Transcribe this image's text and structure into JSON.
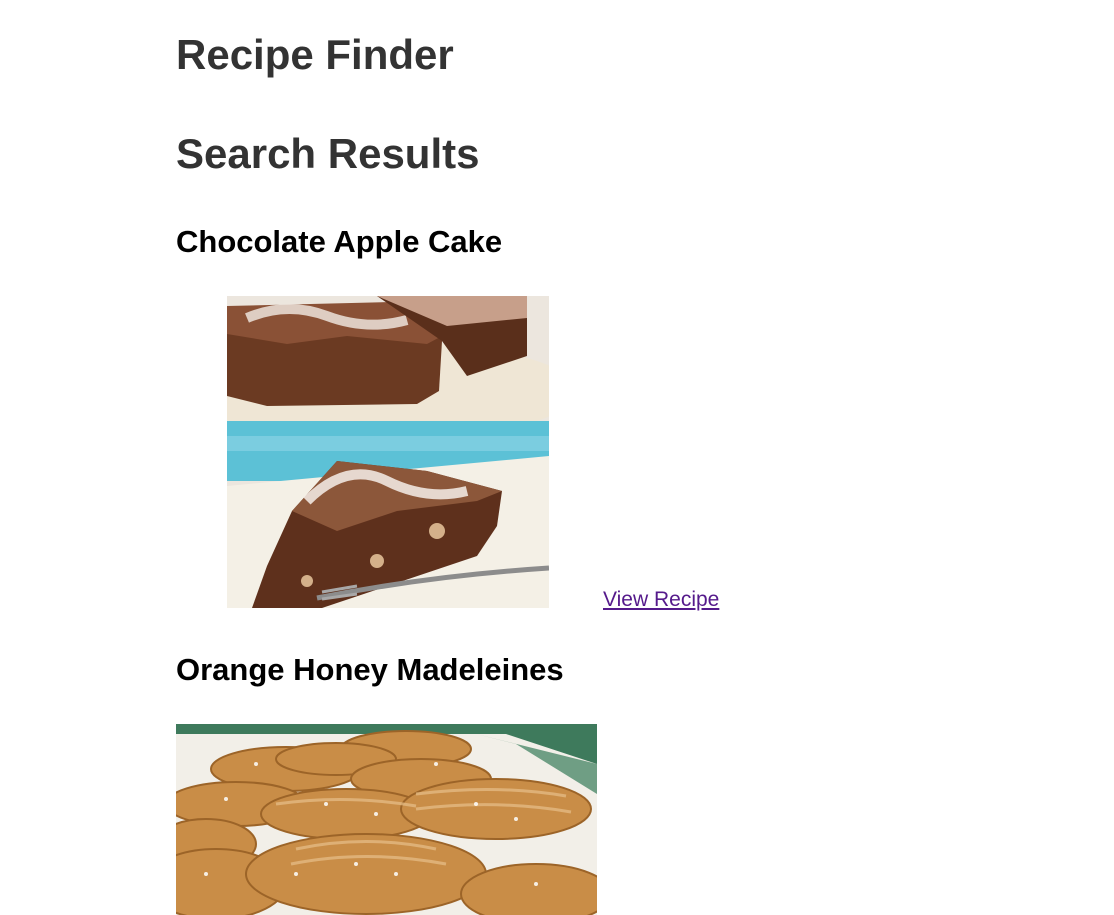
{
  "site": {
    "title": "Recipe Finder"
  },
  "results": {
    "heading": "Search Results",
    "items": [
      {
        "name": "Chocolate Apple Cake",
        "link_label": "View Recipe"
      },
      {
        "name": "Orange Honey Madeleines"
      }
    ]
  },
  "colors": {
    "heading_text": "#333333",
    "visited_link": "#551a8b"
  }
}
